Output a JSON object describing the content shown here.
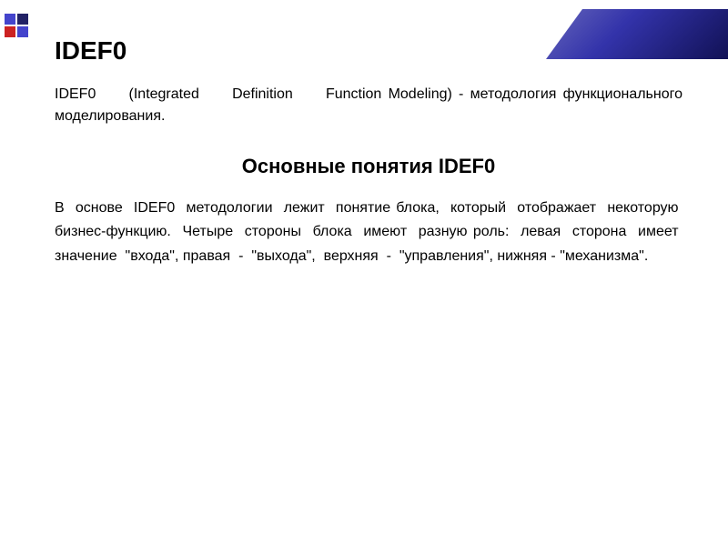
{
  "decorations": {
    "corner_squares": [
      {
        "color": "blue"
      },
      {
        "color": "dark"
      },
      {
        "color": "red"
      },
      {
        "color": "blue"
      }
    ]
  },
  "main_title": "IDEF0",
  "intro_paragraph": "IDEF0    (Integrated    Definition    Function Modeling) - методология функционального моделирования.",
  "section_title": "Основные понятия IDEF0",
  "body_paragraph": "В  основе  IDEF0  методологии  лежит  понятие блока,  который  отображает  некоторую  бизнес-функцию.  Четыре  стороны  блока  имеют  разную роль:  левая  сторона  имеет  значение  \"входа\", правая  -  \"выхода\",  верхняя  -  \"управления\", нижняя - \"механизма\"."
}
